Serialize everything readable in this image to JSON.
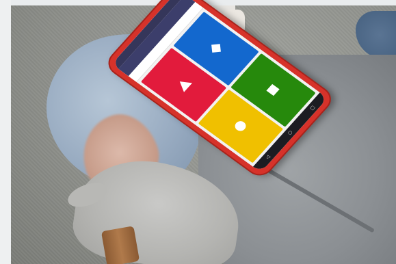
{
  "photo": {
    "description_icons": [
      "triangle-icon",
      "diamond-icon",
      "circle-icon",
      "square-icon"
    ]
  },
  "phone_screen": {
    "colors": {
      "red": "#e21b3c",
      "blue": "#1368ce",
      "yellow": "#f0c000",
      "green": "#26890c",
      "header": "#3c3e6b"
    },
    "answer_tiles": [
      {
        "color": "red",
        "shape": "triangle-icon"
      },
      {
        "color": "blue",
        "shape": "diamond-icon"
      },
      {
        "color": "yellow",
        "shape": "circle-icon"
      },
      {
        "color": "green",
        "shape": "square-icon"
      }
    ]
  }
}
